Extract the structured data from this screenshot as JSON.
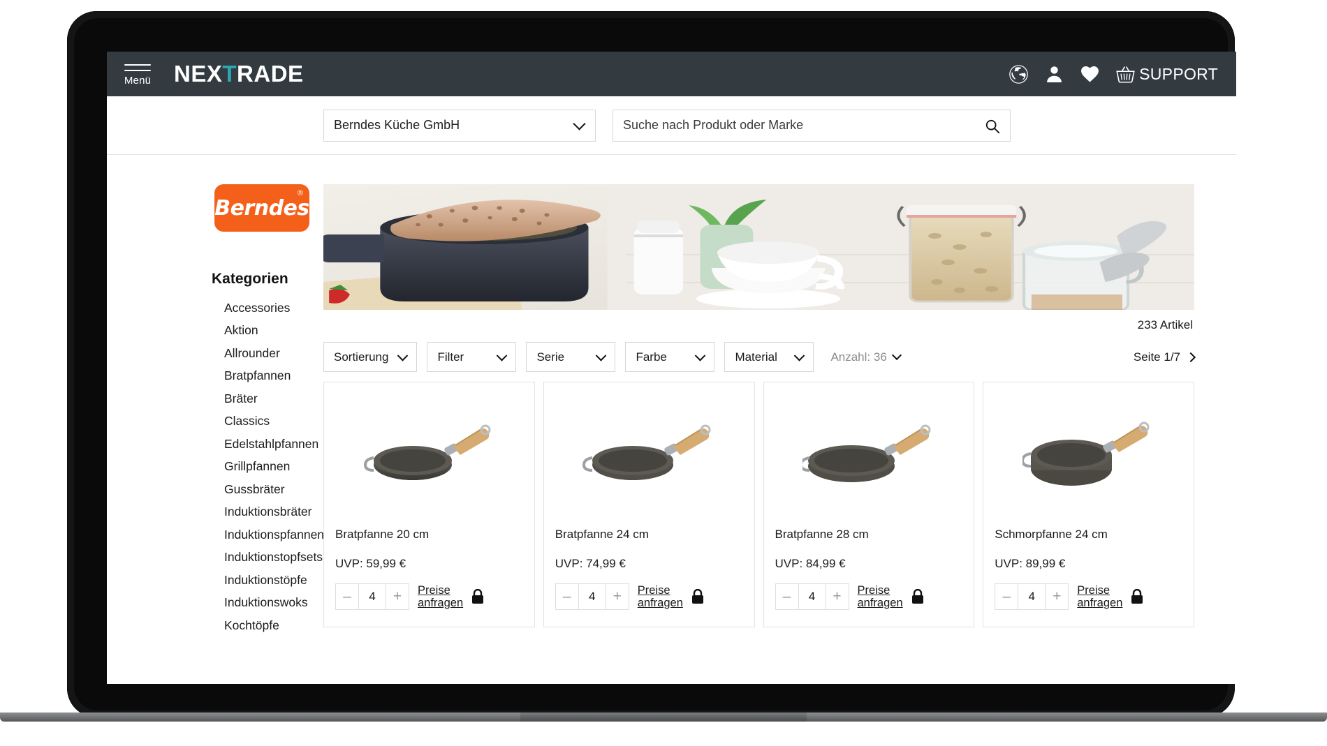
{
  "header": {
    "menu_label": "Menü",
    "brand_pre": "NEX",
    "brand_t": "T",
    "brand_post": "RADE",
    "support_label": "SUPPORT",
    "icons": [
      "globe-icon",
      "user-icon",
      "heart-icon",
      "basket-icon"
    ],
    "background_color": "#333b40",
    "accent_color": "#2aa8b4"
  },
  "search": {
    "vendor_value": "Berndes Küche GmbH",
    "search_value": "",
    "search_placeholder": "Suche nach Produkt oder Marke"
  },
  "sidebar": {
    "logo_word": "Berndes",
    "logo_registered": "®",
    "logo_color": "#f4601a",
    "categories_title": "Kategorien",
    "categories": [
      "Accessories",
      "Aktion",
      "Allrounder",
      "Bratpfannen",
      "Bräter",
      "Classics",
      "Edelstahlpfannen",
      "Grillpfannen",
      "Gussbräter",
      "Induktionsbräter",
      "Induktionspfannen",
      "Induktionstopfsets",
      "Induktionstöpfe",
      "Induktionswoks",
      "Kochtöpfe"
    ]
  },
  "main": {
    "article_count": "233 Artikel",
    "filters": [
      {
        "label": "Sortierung"
      },
      {
        "label": "Filter"
      },
      {
        "label": "Serie"
      },
      {
        "label": "Farbe"
      },
      {
        "label": "Material"
      }
    ],
    "anzahl_label": "Anzahl: 36",
    "page_label": "Seite 1/7",
    "products": [
      {
        "title": "Bratpfanne 20 cm",
        "price": "UVP: 59,99 €",
        "quantity": "4",
        "minus": "–",
        "plus": "+",
        "ask_line1": "Preise",
        "ask_line2": "anfragen"
      },
      {
        "title": "Bratpfanne 24 cm",
        "price": "UVP: 74,99 €",
        "quantity": "4",
        "minus": "–",
        "plus": "+",
        "ask_line1": "Preise",
        "ask_line2": "anfragen"
      },
      {
        "title": "Bratpfanne 28 cm",
        "price": "UVP: 84,99 €",
        "quantity": "4",
        "minus": "–",
        "plus": "+",
        "ask_line1": "Preise",
        "ask_line2": "anfragen"
      },
      {
        "title": "Schmorpfanne 24 cm",
        "price": "UVP: 89,99 €",
        "quantity": "4",
        "minus": "–",
        "plus": "+",
        "ask_line1": "Preise",
        "ask_line2": "anfragen"
      }
    ]
  }
}
